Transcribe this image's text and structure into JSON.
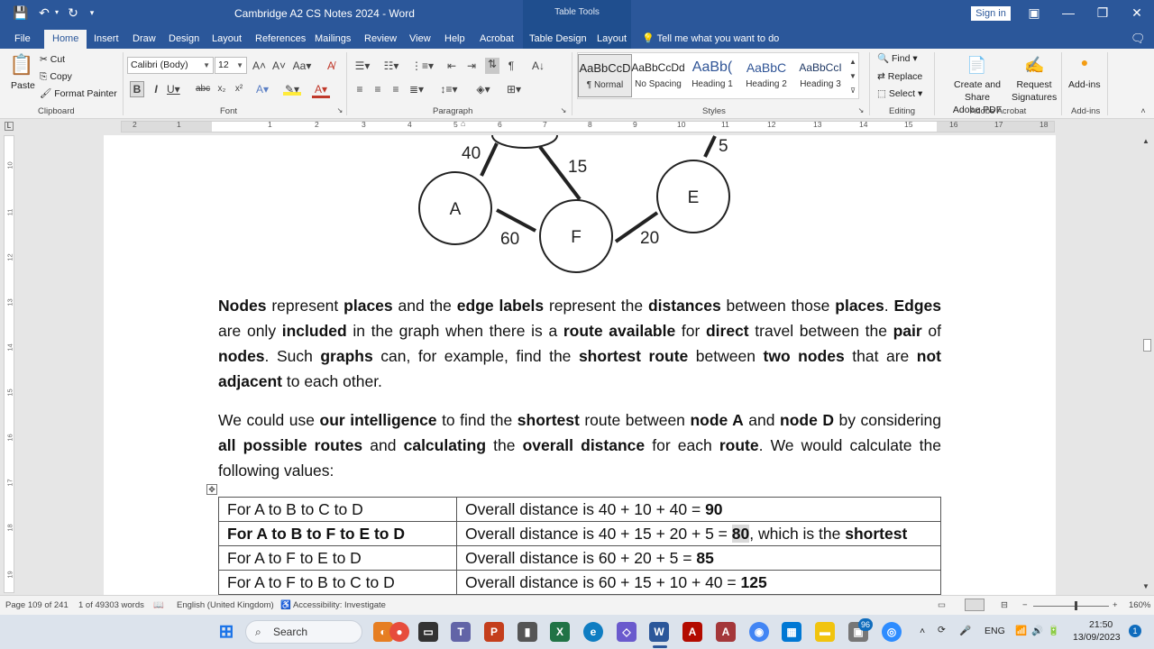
{
  "titlebar": {
    "doc_title": "Cambridge A2 CS Notes 2024  -  Word",
    "table_tools": "Table Tools",
    "sign_in": "Sign in"
  },
  "tabs": [
    "File",
    "Home",
    "Insert",
    "Draw",
    "Design",
    "Layout",
    "References",
    "Mailings",
    "Review",
    "View",
    "Help",
    "Acrobat",
    "Table Design",
    "Layout"
  ],
  "tell_me": "Tell me what you want to do",
  "ribbon": {
    "clipboard": {
      "paste": "Paste",
      "cut": "Cut",
      "copy": "Copy",
      "format_painter": "Format Painter",
      "label": "Clipboard"
    },
    "font": {
      "family": "Calibri (Body)",
      "size": "12",
      "label": "Font"
    },
    "paragraph": {
      "label": "Paragraph"
    },
    "styles": {
      "items": [
        {
          "preview": "AaBbCcD",
          "name": "¶ Normal"
        },
        {
          "preview": "AaBbCcDd",
          "name": "No Spacing"
        },
        {
          "preview": "AaBb(",
          "name": "Heading 1"
        },
        {
          "preview": "AaBbC",
          "name": "Heading 2"
        },
        {
          "preview": "AaBbCcI",
          "name": "Heading 3"
        }
      ],
      "label": "Styles"
    },
    "editing": {
      "find": "Find",
      "replace": "Replace",
      "select": "Select",
      "label": "Editing"
    },
    "acrobat": {
      "create_share": "Create and Share",
      "adobe_pdf": "Adobe PDF",
      "request": "Request",
      "signatures": "Signatures",
      "label": "Adobe Acrobat"
    },
    "addins": {
      "button": "Add-ins",
      "label": "Add-ins"
    }
  },
  "ruler": {
    "h_numbers": [
      "2",
      "1",
      "1",
      "2",
      "3",
      "4",
      "5",
      "6",
      "7",
      "8",
      "9",
      "10",
      "11",
      "12",
      "13",
      "14",
      "15",
      "16",
      "17",
      "18"
    ],
    "v_numbers": [
      "10",
      "11",
      "12",
      "13",
      "14",
      "15",
      "16",
      "17",
      "18",
      "19"
    ]
  },
  "graph": {
    "nodes": [
      "A",
      "F",
      "E"
    ],
    "edge_labels": [
      "40",
      "15",
      "5",
      "60",
      "20"
    ]
  },
  "document": {
    "p1": "<b>Nodes</b> represent <b>places</b> and the <b>edge labels</b> represent the <b>distances</b> between those <b>places</b>. <b>Edges</b> are only <b>included</b> in the graph when there is a <b>route available</b> for <b>direct</b> travel between the <b>pair</b> of <b>nodes</b>. Such <b>graphs</b> can, for example, find the <b>shortest route</b> between <b>two nodes</b> that are <b>not adjacent</b> to each other.",
    "p2": "We could use <b>our intelligence</b> to find the <b>shortest</b> route between <b>node A</b> and <b>node D</b> by considering <b>all possible routes</b> and <b>calculating</b> the <b>overall distance</b> for each <b>route</b>. We would calculate the following values:",
    "rows": [
      {
        "route": "For A to B to C to D",
        "calc": "Overall distance is 40 + 10 + 40 = ",
        "total": "90",
        "suffix": ""
      },
      {
        "route": "For A to B to F to E to D",
        "calc": "Overall distance is 40 + 15 + 20 + 5 = ",
        "total": "80",
        "suffix": ", which is the ",
        "suffix_bold": "shortest"
      },
      {
        "route": "For A to F to E to D",
        "calc": "Overall distance is 60 + 20 + 5 = ",
        "total": "85",
        "suffix": ""
      },
      {
        "route": "For A to F to B to C to D",
        "calc": "Overall distance is 60 + 15 + 10 + 40 = ",
        "total": "125",
        "suffix": ""
      }
    ]
  },
  "status": {
    "page": "Page 109 of 241",
    "words": "1 of 49303 words",
    "language": "English (United Kingdom)",
    "accessibility": "Accessibility: Investigate",
    "zoom": "160%"
  },
  "taskbar": {
    "search": "Search",
    "lang": "ENG",
    "time": "21:50",
    "date": "13/09/2023",
    "badge_count": "96",
    "notif_count": "1"
  }
}
